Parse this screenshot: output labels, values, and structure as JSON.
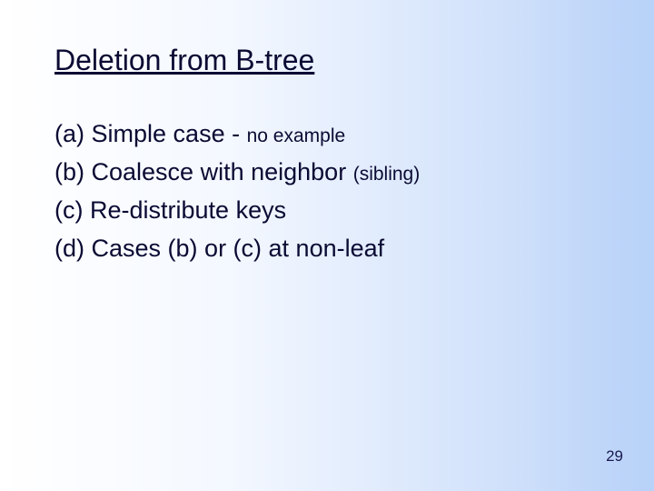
{
  "title": "Deletion from B-tree",
  "items": {
    "a": {
      "label": "(a)",
      "text": "Simple case -",
      "suffix": "no example"
    },
    "b": {
      "label": "(b)",
      "text": "Coalesce with neighbor",
      "suffix": "(sibling)"
    },
    "c": {
      "label": "(c)",
      "text": "Re-distribute keys"
    },
    "d": {
      "label": "(d)",
      "text": "Cases (b) or (c) at non-leaf"
    }
  },
  "page_number": "29"
}
